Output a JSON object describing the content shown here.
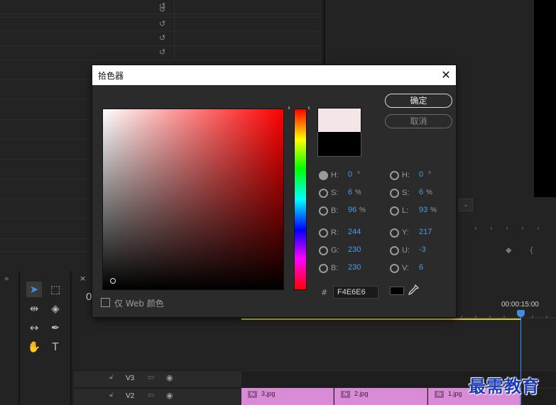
{
  "dialog": {
    "title": "拾色器",
    "ok_label": "确定",
    "cancel_label": "取消",
    "web_only_label": "仅 Web 颜色",
    "hex_hash": "#",
    "hex_value": "F4E6E6",
    "new_color": "#f4e6e6",
    "old_color": "#000000",
    "hsb": {
      "h": {
        "label": "H:",
        "value": "0",
        "unit": "°"
      },
      "s": {
        "label": "S:",
        "value": "6",
        "unit": "%"
      },
      "b": {
        "label": "B:",
        "value": "96",
        "unit": "%"
      }
    },
    "rgb": {
      "r": {
        "label": "R:",
        "value": "244"
      },
      "g": {
        "label": "G:",
        "value": "230"
      },
      "b": {
        "label": "B:",
        "value": "230"
      }
    },
    "hsl": {
      "h": {
        "label": "H:",
        "value": "0",
        "unit": "°"
      },
      "s": {
        "label": "S:",
        "value": "6",
        "unit": "%"
      },
      "l": {
        "label": "L:",
        "value": "93",
        "unit": "%"
      }
    },
    "yuv": {
      "y": {
        "label": "Y:",
        "value": "217"
      },
      "u": {
        "label": "U:",
        "value": "-3"
      },
      "v": {
        "label": "V:",
        "value": "6"
      }
    }
  },
  "timeline": {
    "timecode": "00:00:15:00",
    "current_time_partial": "0",
    "tracks": [
      {
        "label": "V3"
      },
      {
        "label": "V2"
      }
    ],
    "clips": [
      {
        "name": "3.jpg",
        "fx": "fx"
      },
      {
        "name": "2.jpg",
        "fx": "fx"
      },
      {
        "name": "1.jpg",
        "fx": "fx"
      }
    ]
  },
  "watermark": "最需教育"
}
